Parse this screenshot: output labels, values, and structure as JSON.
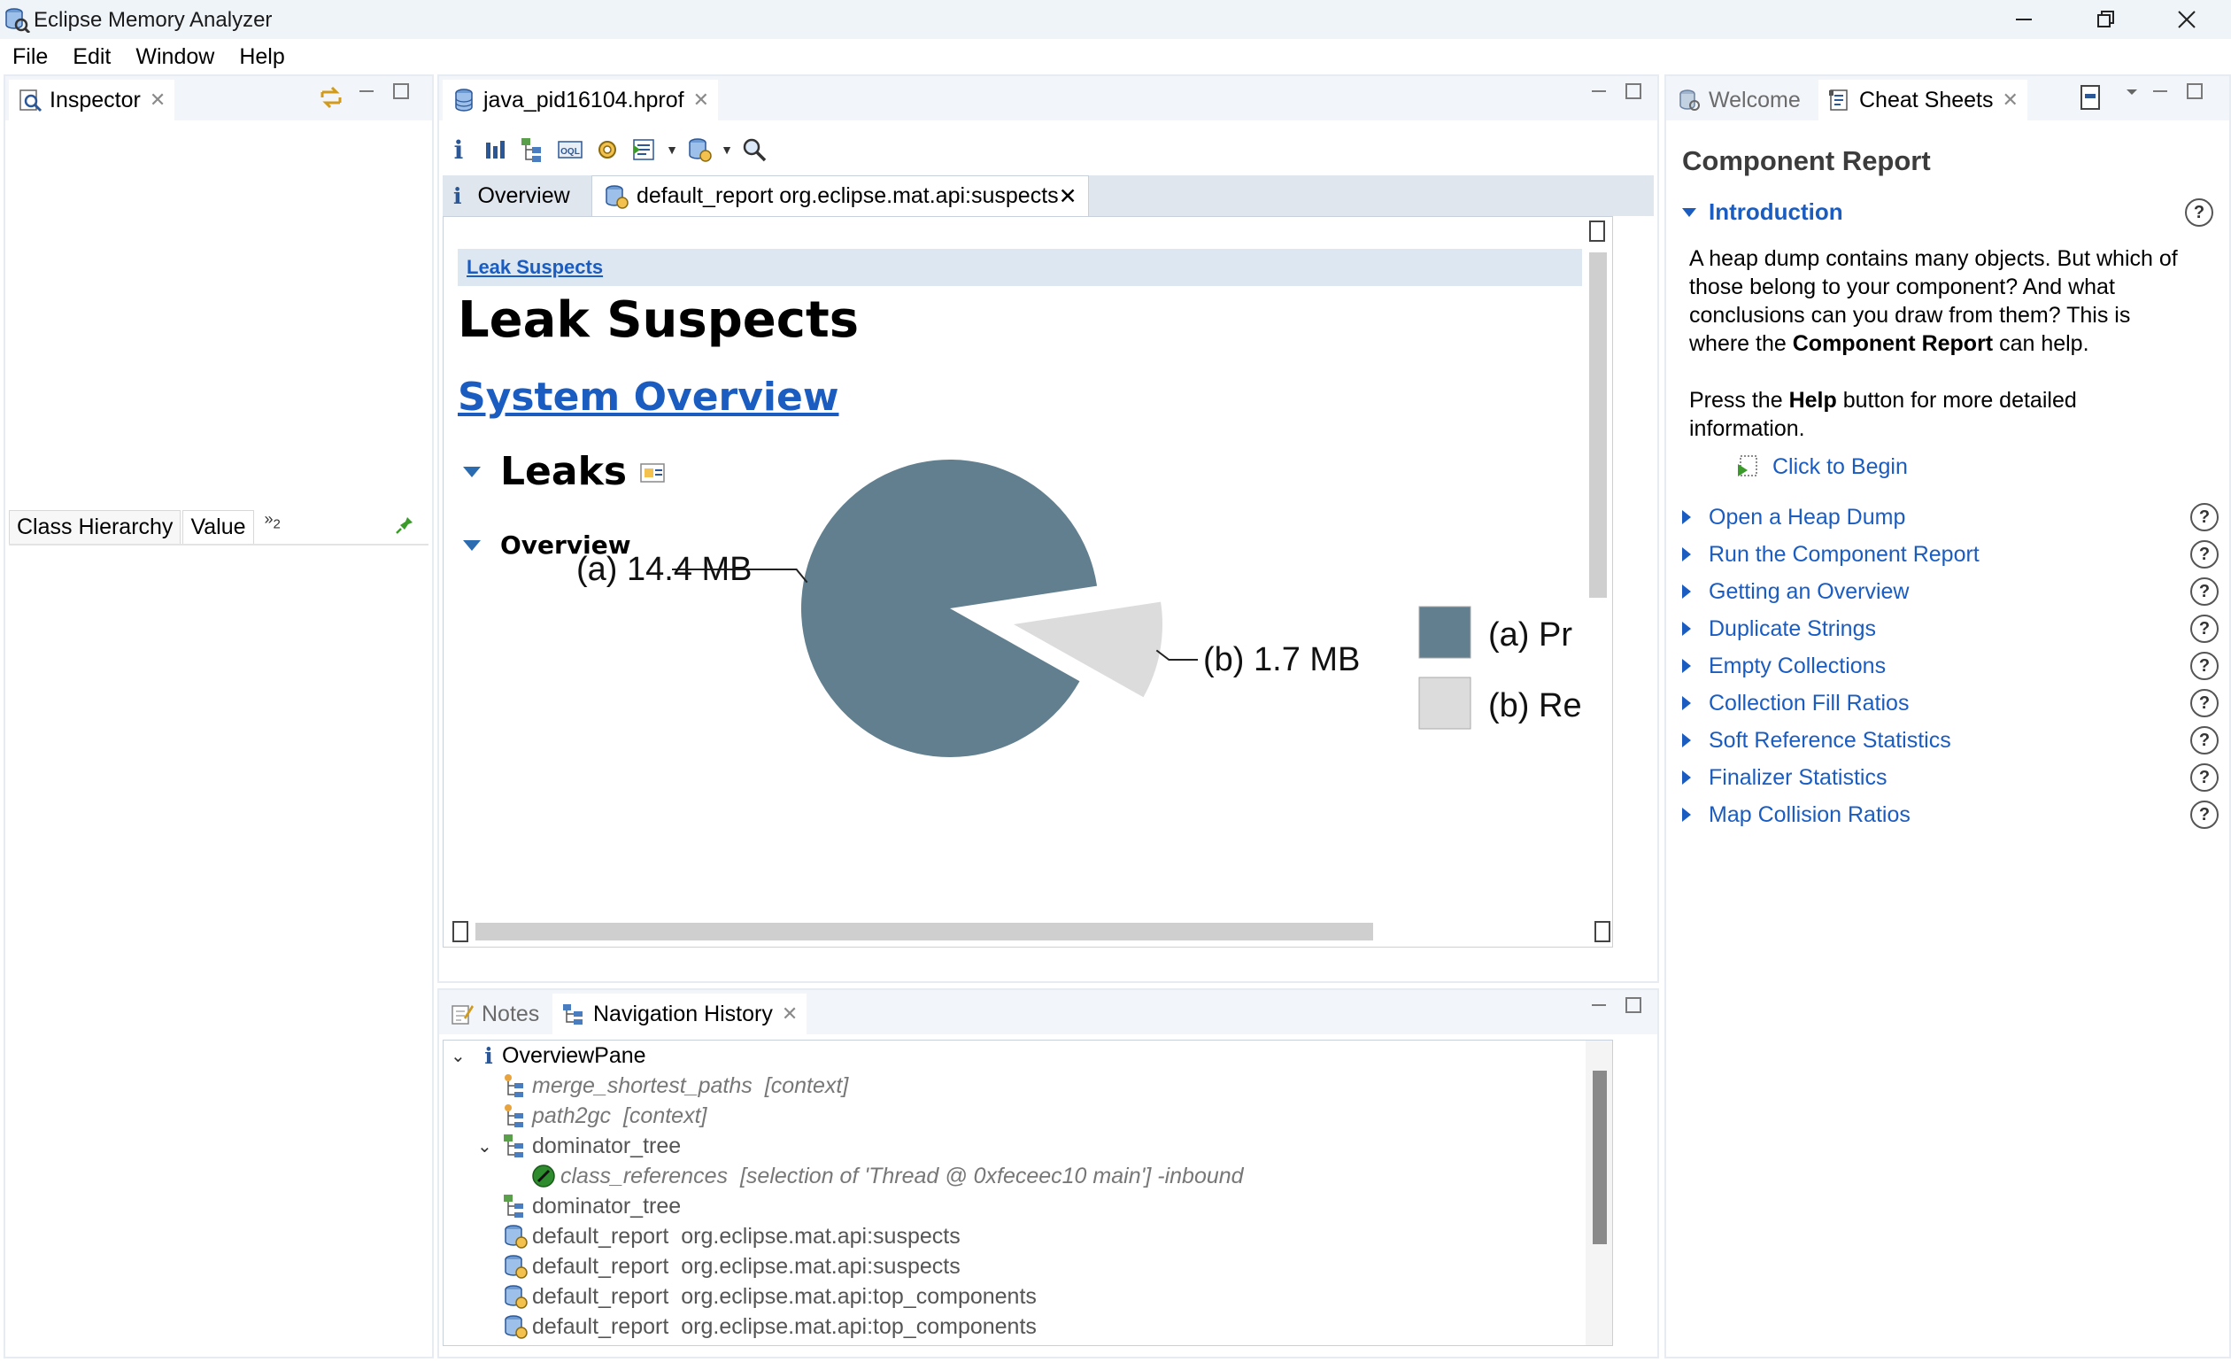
{
  "window": {
    "title": "Eclipse Memory Analyzer"
  },
  "menu": [
    "File",
    "Edit",
    "Window",
    "Help"
  ],
  "inspector": {
    "tab_label": "Inspector",
    "subtabs": [
      "Class Hierarchy",
      "Value"
    ],
    "overflow_count": "2"
  },
  "editor": {
    "file_tab": "java_pid16104.hprof",
    "tabs": [
      {
        "label": "Overview"
      },
      {
        "label": "default_report  org.eclipse.mat.api:suspects"
      }
    ],
    "report": {
      "breadcrumb": "Leak Suspects",
      "title": "Leak Suspects",
      "system_overview": "System Overview",
      "leaks_heading": "Leaks",
      "overview_heading": "Overview"
    }
  },
  "chart_data": {
    "type": "pie",
    "slices": [
      {
        "label": "(a)  14.4 MB",
        "legend": "(a)  Pr",
        "value": 14.4,
        "color": "#617f8e"
      },
      {
        "label": "(b)  1.7 MB",
        "legend": "(b)  Re",
        "value": 1.7,
        "color": "#dcdcdc"
      }
    ],
    "units": "MB"
  },
  "cheatsheet": {
    "tabs": {
      "welcome": "Welcome",
      "cheat_sheets": "Cheat Sheets"
    },
    "title": "Component Report",
    "intro": {
      "heading": "Introduction",
      "p1_a": "A heap dump contains many objects. But which of those belong to your component? And what conclusions can you draw from them? This is where the ",
      "p1_bold": "Component Report",
      "p1_b": " can help.",
      "p2_a": "Press the ",
      "p2_bold": "Help",
      "p2_b": " button for more detailed information."
    },
    "click_to_begin": "Click to Begin",
    "steps": [
      "Open a Heap Dump",
      "Run the Component Report",
      "Getting an Overview",
      "Duplicate Strings",
      "Empty Collections",
      "Collection Fill Ratios",
      "Soft Reference Statistics",
      "Finalizer Statistics",
      "Map Collision Ratios"
    ],
    "help_glyph": "?"
  },
  "bottom": {
    "tabs": {
      "notes": "Notes",
      "nav_history": "Navigation History"
    },
    "tree": {
      "root": "OverviewPane",
      "merge": {
        "name": "merge_shortest_paths",
        "ctx": "[context]"
      },
      "path2gc": {
        "name": "path2gc",
        "ctx": "[context]"
      },
      "dom1": "dominator_tree",
      "class_refs": {
        "name": "class_references",
        "ctx": "[selection of 'Thread @ 0xfeceec10  main'] -inbound"
      },
      "dom2": "dominator_tree",
      "reports": [
        {
          "name": "default_report",
          "arg": "org.eclipse.mat.api:suspects"
        },
        {
          "name": "default_report",
          "arg": "org.eclipse.mat.api:suspects"
        },
        {
          "name": "default_report",
          "arg": "org.eclipse.mat.api:top_components"
        },
        {
          "name": "default_report",
          "arg": "org.eclipse.mat.api:top_components"
        }
      ]
    }
  }
}
